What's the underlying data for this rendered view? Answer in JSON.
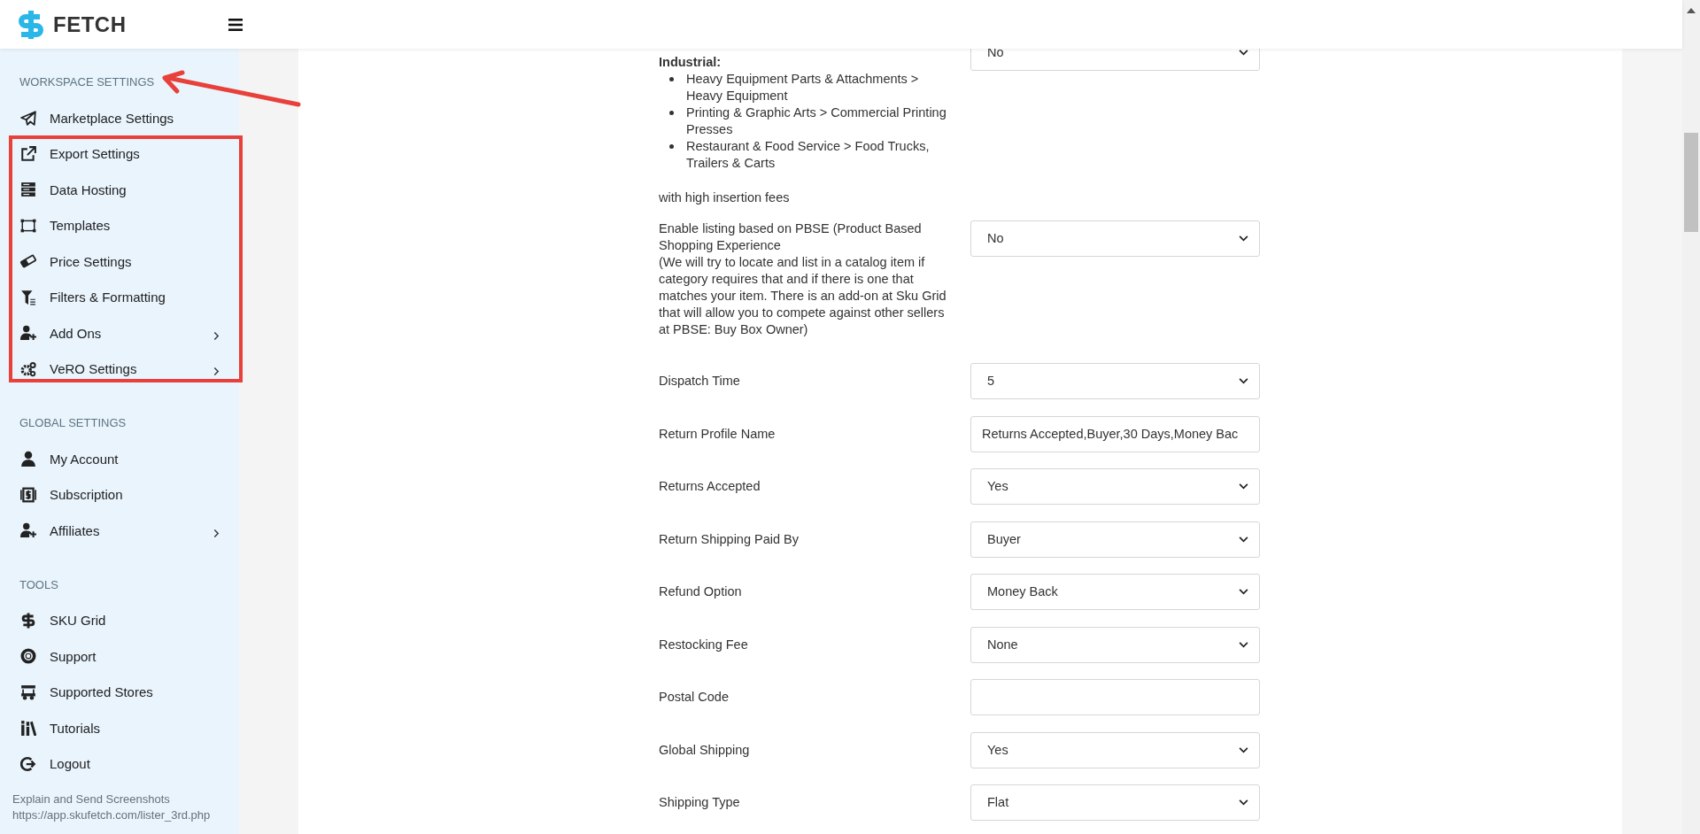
{
  "header": {
    "logo_text": "FETCH"
  },
  "sidebar": {
    "sections": [
      {
        "title": "WORKSPACE SETTINGS",
        "items": [
          {
            "label": "Marketplace Settings",
            "submenu": false
          },
          {
            "label": "Export Settings",
            "submenu": false
          },
          {
            "label": "Data Hosting",
            "submenu": false
          },
          {
            "label": "Templates",
            "submenu": false
          },
          {
            "label": "Price Settings",
            "submenu": false
          },
          {
            "label": "Filters & Formatting",
            "submenu": false
          },
          {
            "label": "Add Ons",
            "submenu": true
          },
          {
            "label": "VeRO Settings",
            "submenu": true
          }
        ]
      },
      {
        "title": "GLOBAL SETTINGS",
        "items": [
          {
            "label": "My Account",
            "submenu": false
          },
          {
            "label": "Subscription",
            "submenu": false
          },
          {
            "label": "Affiliates",
            "submenu": true
          }
        ]
      },
      {
        "title": "TOOLS",
        "items": [
          {
            "label": "SKU Grid",
            "submenu": false
          },
          {
            "label": "Support",
            "submenu": false
          },
          {
            "label": "Supported Stores",
            "submenu": false
          },
          {
            "label": "Tutorials",
            "submenu": false
          },
          {
            "label": "Logout",
            "submenu": false
          }
        ]
      }
    ],
    "footer_note": [
      "Explain and Send Screenshots",
      "https://app.skufetch.com/lister_3rd.php"
    ]
  },
  "form": {
    "category_field": {
      "heading": "Industrial:",
      "bullets": [
        "Heavy Equipment Parts & Attachments > Heavy Equipment",
        "Printing & Graphic Arts > Commercial Printing Presses",
        "Restaurant & Food Service > Food Trucks, Trailers & Carts"
      ],
      "note": "with high insertion fees",
      "value": "No"
    },
    "rows": [
      {
        "kind": "select",
        "label": "Enable listing based on PBSE (Product Based Shopping Experience",
        "detail": "(We will try to locate and list in a catalog item if category requires that and if there is one that matches your item. There is an add-on at Sku Grid that will allow you to compete against other sellers at PBSE: Buy Box Owner)",
        "value": "No"
      },
      {
        "kind": "select",
        "label": "Dispatch Time",
        "value": "5"
      },
      {
        "kind": "input",
        "label": "Return Profile Name",
        "value": "Returns Accepted,Buyer,30 Days,Money Bac"
      },
      {
        "kind": "select",
        "label": "Returns Accepted",
        "value": "Yes"
      },
      {
        "kind": "select",
        "label": "Return Shipping Paid By",
        "value": "Buyer"
      },
      {
        "kind": "select",
        "label": "Refund Option",
        "value": "Money Back"
      },
      {
        "kind": "select",
        "label": "Restocking Fee",
        "value": "None"
      },
      {
        "kind": "input",
        "label": "Postal Code"
      },
      {
        "kind": "select",
        "label": "Global Shipping",
        "value": "Yes"
      },
      {
        "kind": "select",
        "label": "Shipping Type",
        "value": "Flat"
      }
    ]
  }
}
